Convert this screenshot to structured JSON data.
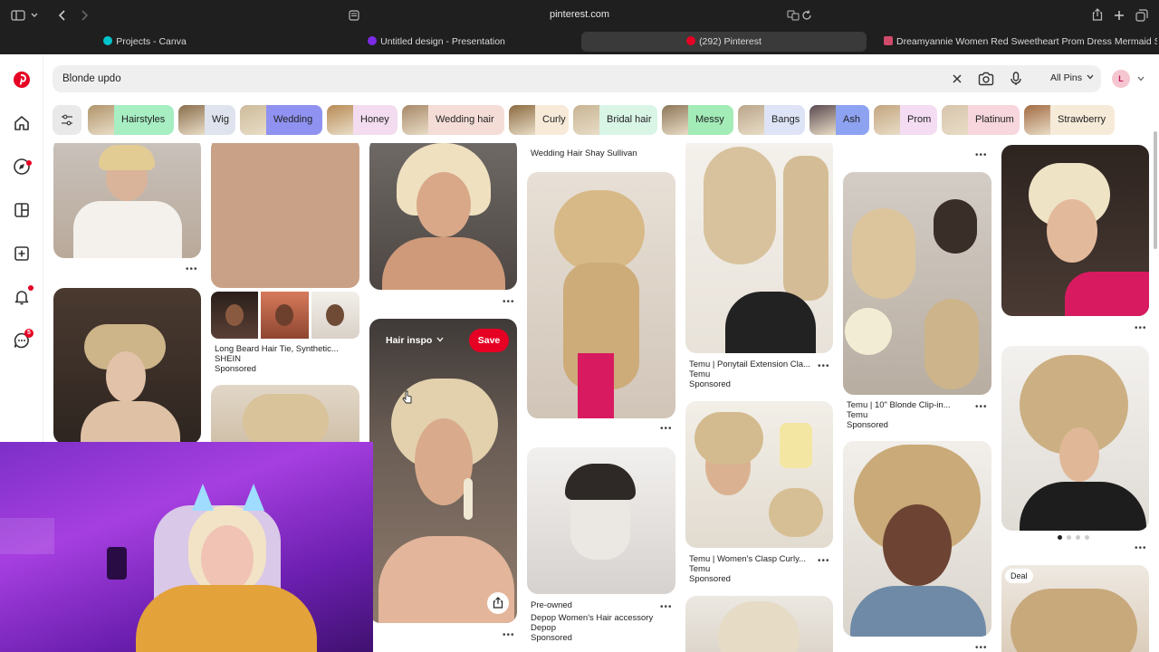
{
  "browser": {
    "url": "pinterest.com",
    "tabs": [
      {
        "label": "Projects - Canva",
        "color": "#00c4cc"
      },
      {
        "label": "Untitled design - Presentation",
        "color": "#7d2ae8"
      },
      {
        "label": "(292) Pinterest",
        "color": "#e60023"
      },
      {
        "label": "Dreamyannie Women Red Sweetheart Prom Dress Mermaid Stunnin...",
        "color": "#d04a6a"
      }
    ]
  },
  "sidebar": {
    "icons": [
      "pinterest-logo-icon",
      "home-icon",
      "explore-icon",
      "boards-icon",
      "create-icon",
      "notifications-icon",
      "messages-icon"
    ],
    "messages_badge": "5"
  },
  "search": {
    "value": "Blonde updo",
    "filter_label": "All Pins",
    "avatar_initial": "L"
  },
  "chips": [
    {
      "label": "Hairstyles",
      "color": "#a7eec3",
      "thumb": "#b0946a"
    },
    {
      "label": "Wig",
      "color": "#dfe3ee",
      "thumb": "#8a6e4c"
    },
    {
      "label": "Wedding",
      "color": "#8f92f0",
      "thumb": "#cdbb9a"
    },
    {
      "label": "Honey",
      "color": "#f3dcef",
      "thumb": "#b88b55"
    },
    {
      "label": "Wedding hair",
      "color": "#f5ddd7",
      "thumb": "#a78868"
    },
    {
      "label": "Curly",
      "color": "#f7ead8",
      "thumb": "#8b6a3f"
    },
    {
      "label": "Bridal hair",
      "color": "#d8f5e6",
      "thumb": "#c7b493"
    },
    {
      "label": "Messy",
      "color": "#a3ecb8",
      "thumb": "#8d7657"
    },
    {
      "label": "Bangs",
      "color": "#dee4f6",
      "thumb": "#b9a58a"
    },
    {
      "label": "Ash",
      "color": "#8ea2f2",
      "thumb": "#5a4a50"
    },
    {
      "label": "Prom",
      "color": "#f4dcf2",
      "thumb": "#c3a57f"
    },
    {
      "label": "Platinum",
      "color": "#f7d6de",
      "thumb": "#d7c5ac"
    },
    {
      "label": "Strawberry",
      "color": "#f6ead8",
      "thumb": "#a26a42"
    }
  ],
  "pins": {
    "wedding_caption": "Wedding Hair Shay Sullivan",
    "beard_title": "Long Beard Hair Tie, Synthetic...",
    "beard_brand": "SHEIN",
    "sponsored": "Sponsored",
    "board_name": "Hair inspo",
    "save_label": "Save",
    "ponytail_title": "Temu | Ponytail Extension Cla...",
    "temu": "Temu",
    "clipin_title": "Temu | 10\" Blonde Clip-in...",
    "clasp_title": "Temu | Women's Clasp Curly...",
    "preowned": "Pre-owned",
    "depop_title": "Depop Women's Hair accessory",
    "depop_brand": "Depop",
    "deal": "Deal"
  }
}
